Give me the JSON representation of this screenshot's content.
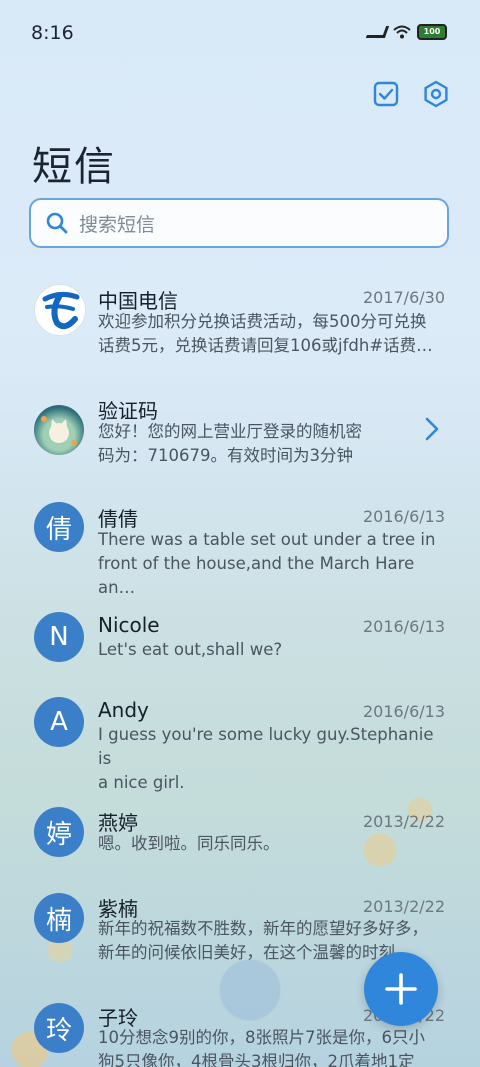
{
  "status_bar": {
    "time": "8:16",
    "battery": "100"
  },
  "header": {
    "title": "短信"
  },
  "search": {
    "placeholder": "搜索短信"
  },
  "colors": {
    "accent": "#2f86da",
    "avatar_bg": "#3b7fc8"
  },
  "messages": [
    {
      "name": "中国电信",
      "date": "2017/6/30",
      "avatar_type": "telecom-logo",
      "preview_lines": [
        "欢迎参加积分兑换话费活动，每500分可兑换",
        "话费5元，兑换话费请回复106或jfdh#话费…"
      ]
    },
    {
      "name": "验证码",
      "date": "",
      "avatar_type": "cat-photo",
      "preview_lines": [
        "您好！您的网上营业厅登录的随机密",
        "码为：710679。有效时间为3分钟"
      ]
    },
    {
      "name": "倩倩",
      "date": "2016/6/13",
      "avatar_letter": "倩",
      "preview_lines": [
        "There was a table set out under a tree in",
        "front of the house,and the March Hare an…"
      ]
    },
    {
      "name": "Nicole",
      "date": "2016/6/13",
      "avatar_letter": "N",
      "preview_lines": [
        "Let's eat out,shall we?"
      ]
    },
    {
      "name": "Andy",
      "date": "2016/6/13",
      "avatar_letter": "A",
      "preview_lines": [
        "I guess you're some lucky guy.Stephanie is",
        "a nice girl."
      ]
    },
    {
      "name": "燕婷",
      "date": "2013/2/22",
      "avatar_letter": "婷",
      "preview_lines": [
        "嗯。收到啦。同乐同乐。"
      ]
    },
    {
      "name": "紫楠",
      "date": "2013/2/22",
      "avatar_letter": "楠",
      "preview_lines": [
        "新年的祝福数不胜数，新年的愿望好多好多，",
        "新年的问候依旧美好，在这个温馨的时刻…"
      ]
    },
    {
      "name": "子玲",
      "date": "2013/2/22",
      "avatar_letter": "玲",
      "preview_lines": [
        "10分想念9别的你，8张照片7张是你，6只小",
        "狗5只像你，4根骨头3根归你，2爪着地1定"
      ]
    }
  ]
}
